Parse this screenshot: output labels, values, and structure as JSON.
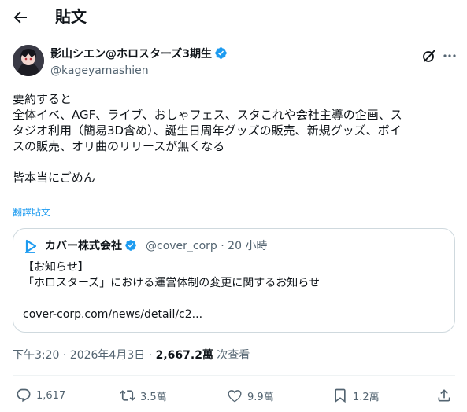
{
  "header": {
    "title": "貼文"
  },
  "author": {
    "name": "影山シエン@ホロスターズ3期生",
    "handle": "@kageyamashien"
  },
  "tweet": {
    "lines": [
      "要約すると",
      "全体イベ、AGF、ライブ、おしゃフェス、スタこれや会社主導の企画、ス",
      "タジオ利用（簡易3D含め）、誕生日周年グッズの販売、新規グッズ、ボイ",
      "スの販売、オリ曲のリリースが無くなる",
      "",
      "皆本当にごめん"
    ],
    "translate_label": "翻譯貼文"
  },
  "quote": {
    "name": "カバー株式会社",
    "handle_time": "@cover_corp · 20 小時",
    "lines": [
      "【お知らせ】",
      "「ホロスターズ」における運営体制の変更に関するお知らせ",
      "",
      "cover-corp.com/news/detail/c2..."
    ]
  },
  "meta": {
    "time_date": "下午3:20 · 2026年4月3日 · ",
    "views": "2,667.2萬",
    "views_label": " 次查看"
  },
  "actions": {
    "replies": "1,617",
    "reposts": "3.5萬",
    "likes": "9.9萬",
    "bookmarks": "1.2萬"
  },
  "colors": {
    "text": "#0f1419",
    "secondary": "#536471",
    "accent": "#1d9bf0",
    "border": "#cfd9de"
  },
  "icons": [
    "back-arrow-icon",
    "verified-badge-icon",
    "grok-icon",
    "more-icon",
    "reply-icon",
    "repost-icon",
    "like-icon",
    "bookmark-icon",
    "share-icon"
  ]
}
